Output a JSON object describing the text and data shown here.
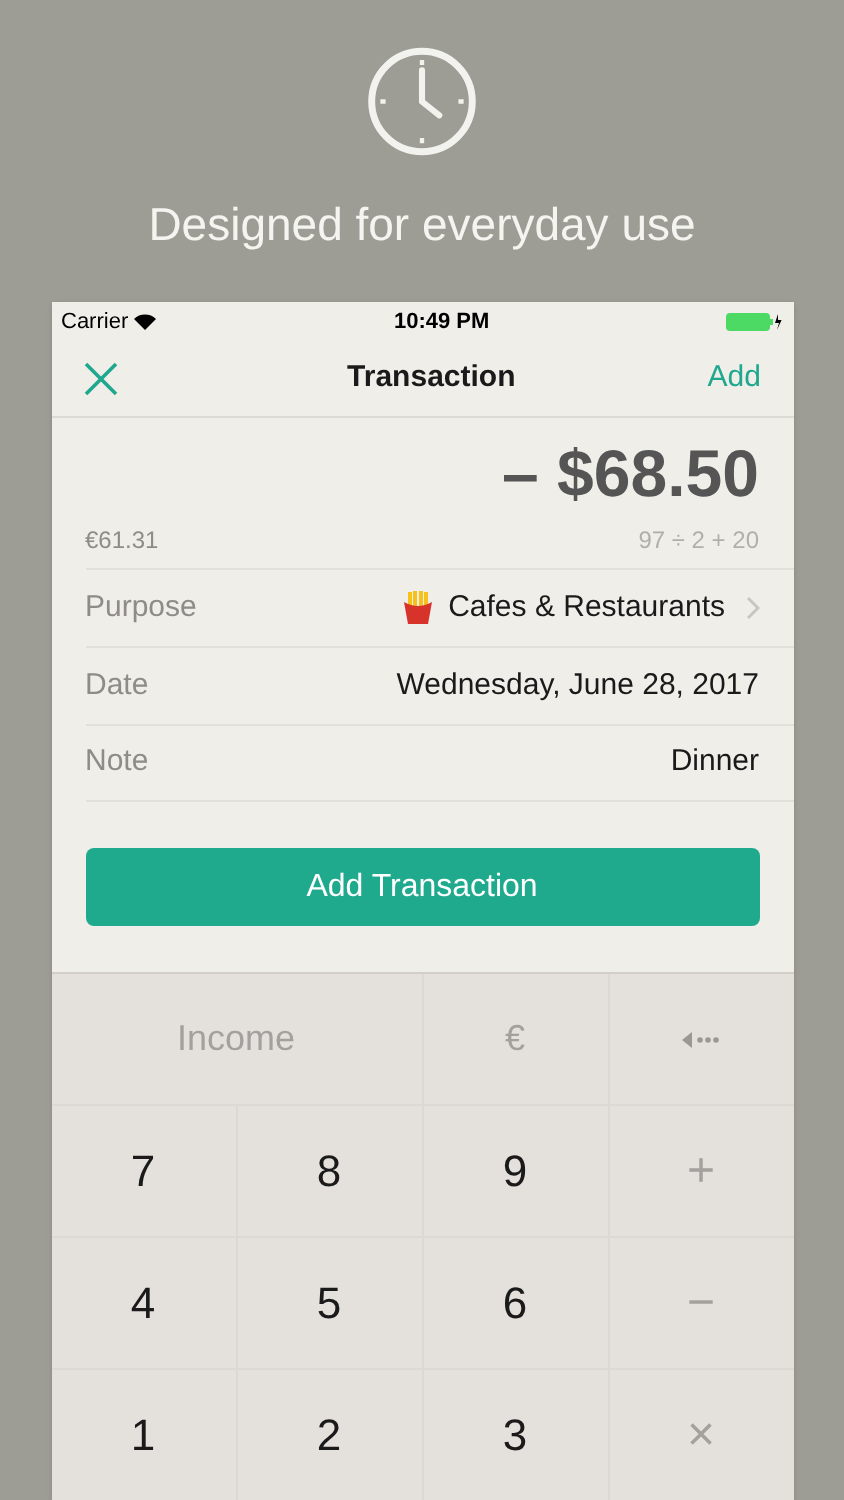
{
  "headline": "Designed for everyday use",
  "status_bar": {
    "carrier": "Carrier",
    "time": "10:49 PM"
  },
  "nav": {
    "title": "Transaction",
    "action": "Add"
  },
  "amount": {
    "value": "– $68.50",
    "converted": "€61.31",
    "expression": "97 ÷ 2 + 20"
  },
  "fields": [
    {
      "label": "Purpose",
      "value": "Cafes & Restaurants",
      "kind": "picker"
    },
    {
      "label": "Date",
      "value": "Wednesday, June 28, 2017",
      "kind": "text"
    },
    {
      "label": "Note",
      "value": "Dinner",
      "kind": "text"
    }
  ],
  "submit": "Add Transaction",
  "keypad": [
    [
      {
        "label": "Income",
        "kind": "function"
      },
      {
        "label": "€",
        "kind": "function"
      },
      {
        "kind": "backspace"
      }
    ],
    [
      {
        "label": "7",
        "kind": "digit"
      },
      {
        "label": "8",
        "kind": "digit"
      },
      {
        "label": "9",
        "kind": "digit"
      },
      {
        "label": "+",
        "kind": "operator"
      }
    ],
    [
      {
        "label": "4",
        "kind": "digit"
      },
      {
        "label": "5",
        "kind": "digit"
      },
      {
        "label": "6",
        "kind": "digit"
      },
      {
        "label": "−",
        "kind": "operator"
      }
    ],
    [
      {
        "label": "1",
        "kind": "digit"
      },
      {
        "label": "2",
        "kind": "digit"
      },
      {
        "label": "3",
        "kind": "digit"
      },
      {
        "label": "×",
        "kind": "operator"
      }
    ]
  ]
}
